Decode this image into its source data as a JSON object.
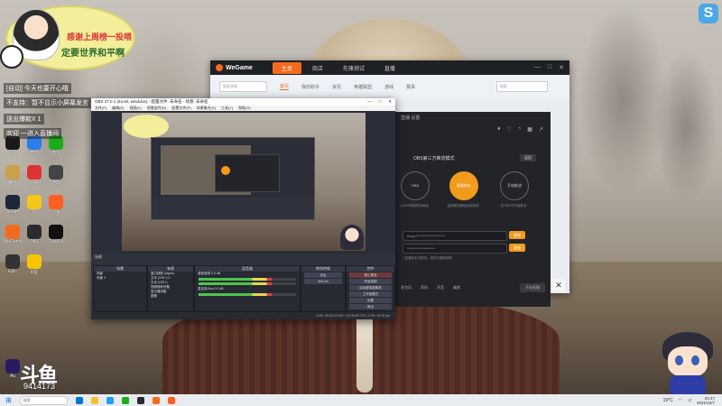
{
  "overlay": {
    "badge_line1": "感谢上周榜一投喂",
    "badge_line2": "定要世界和平啊",
    "notifications": [
      "[自动] 今天也要开心哦",
      "不支持：暂不显示小屏幕发言",
      "送出爆款X 1",
      "欢迎 一进入直播间"
    ],
    "douyu_logo": "斗鱼",
    "douyu_id": "9414173",
    "s_logo": "S"
  },
  "desktop_icons": [
    {
      "label": "QQ",
      "color": "#1a1a1a"
    },
    {
      "label": "酷狗",
      "color": "#2b7de9"
    },
    {
      "label": "微信",
      "color": "#1aad19"
    },
    {
      "label": "魔兽",
      "color": "#c8a24b"
    },
    {
      "label": "网易",
      "color": "#d33"
    },
    {
      "label": "游戏",
      "color": "#444"
    },
    {
      "label": "Steam",
      "color": "#1b2838"
    },
    {
      "label": "YY",
      "color": "#f5c518"
    },
    {
      "label": "斗鱼",
      "color": "#ff5d23"
    },
    {
      "label": "WeGame",
      "color": "#f26b1d"
    },
    {
      "label": "OBS",
      "color": "#2b2b2b"
    },
    {
      "label": "CapCut",
      "color": "#111"
    },
    {
      "label": "Epic",
      "color": "#333"
    },
    {
      "label": "R星",
      "color": "#f7c600"
    },
    {
      "label": "Au",
      "color": "#2a1a60"
    }
  ],
  "wegame": {
    "logo": "WeGame",
    "nav": [
      "主页",
      "商店",
      "先锋测试",
      "直播"
    ],
    "nav_active": 0,
    "sub_search": "搜索游戏",
    "sub_tabs": [
      "首页",
      "我的助手",
      "资讯",
      "英雄联盟",
      "游戏",
      "赛事"
    ],
    "sub_active": 0,
    "search2": "搜索"
  },
  "popup": {
    "head_text": "直播 设置",
    "title": "OBS第三方推流模式",
    "rec_btn": "返回",
    "circles": [
      {
        "label": "OBS",
        "caption": "从OBS获取推流地址"
      },
      {
        "label": "复制地址",
        "caption": "复制服务器地址和密钥"
      },
      {
        "label": "开始推流",
        "caption": "在OBS中开始推流"
      }
    ],
    "field1": "rtmp://********************",
    "field2": "********************",
    "field_btn": "复制",
    "hint": "* 如遇到无法推流，请尝试重新获取",
    "bottom": [
      "麦克风",
      "耳机",
      "声音",
      "美颜"
    ],
    "bottom_btn": "开始直播"
  },
  "obs": {
    "title": "OBS 27.0.1 (64-bit, windows) - 配置文件: 未命名 - 场景: 未命名",
    "menu": [
      "文件(F)",
      "编辑(E)",
      "视图(V)",
      "停靠部件(D)",
      "配置文件(P)",
      "场景集合(S)",
      "工具(T)",
      "帮助(H)"
    ],
    "dock_headers": [
      "场景",
      "来源",
      "混音器",
      "转场特效",
      "控件"
    ],
    "scenes": [
      "场景",
      "场景 2"
    ],
    "sources": [
      "窗口捕获 (wgrm)",
      "文本 (GDI+) 2",
      "文本 (GDI+)",
      "视频捕获设备",
      "显示器采集",
      "图像"
    ],
    "mixer": [
      {
        "name": "桌面音频",
        "db": "0.0 dB"
      },
      {
        "name": "麦克风/Aux",
        "db": "0.0 dB"
      }
    ],
    "transition": "淡出",
    "duration": "300 ms",
    "controls": [
      "停止推流",
      "开始录制",
      "启动虚拟摄像机",
      "工作室模式",
      "设置",
      "退出"
    ],
    "status": "LIVE: 00:25:12  REC: 00:00:00  CPU: 3.9%, 60.00 fps"
  },
  "taskbar": {
    "search": "搜索",
    "weather": "19°C",
    "time": "20:47",
    "date": "2021/10/7"
  }
}
